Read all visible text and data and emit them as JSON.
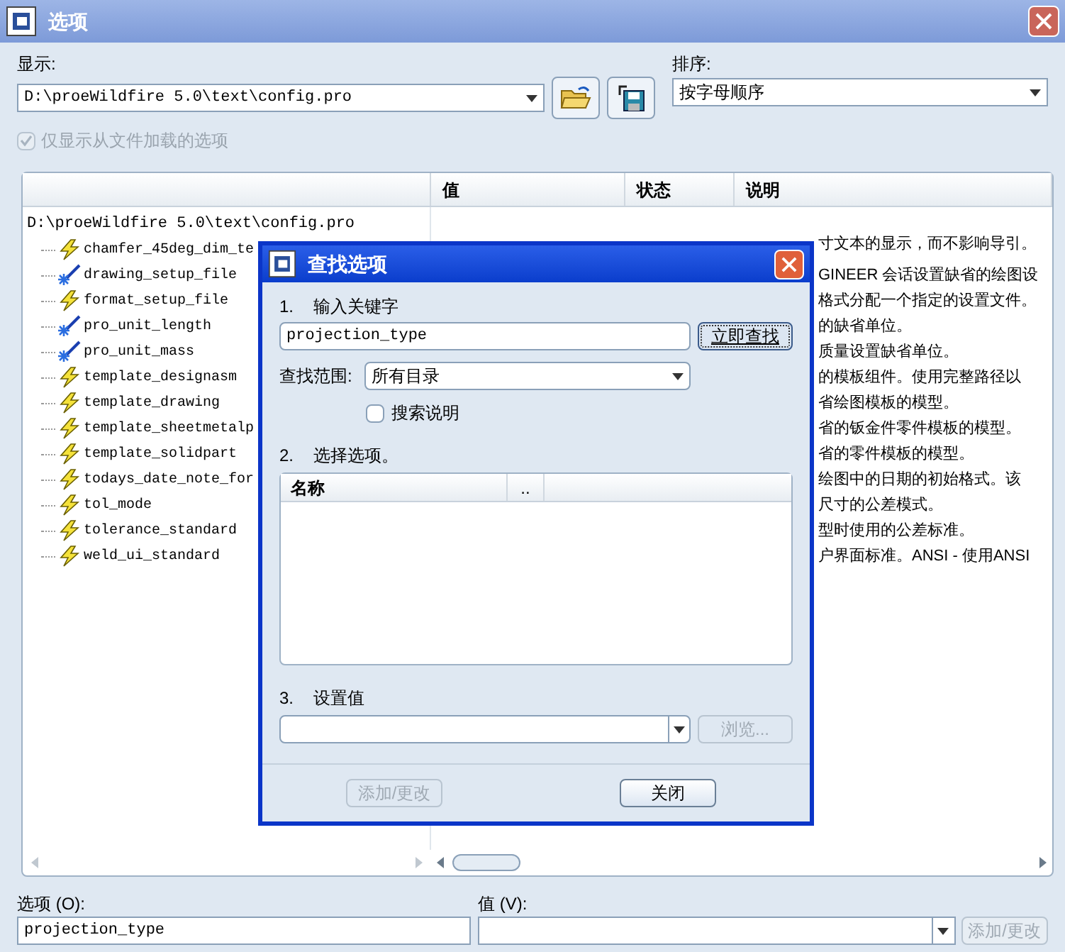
{
  "window": {
    "title": "选项"
  },
  "display": {
    "label": "显示:",
    "value": "D:\\proeWildfire 5.0\\text\\config.pro"
  },
  "sort": {
    "label": "排序:",
    "value": "按字母顺序"
  },
  "only_loaded": {
    "label": "仅显示从文件加载的选项",
    "checked": true,
    "disabled": true
  },
  "table": {
    "columns": [
      "值",
      "状态",
      "说明"
    ],
    "root": "D:\\proeWildfire 5.0\\text\\config.pro",
    "rows": [
      {
        "name": "chamfer_45deg_dim_te",
        "kind": "default",
        "description": "寸文本的显示，而不影响导引。"
      },
      {
        "name": "drawing_setup_file",
        "kind": "changed",
        "description": "GINEER 会话设置缺省的绘图设"
      },
      {
        "name": "format_setup_file",
        "kind": "default",
        "description": "格式分配一个指定的设置文件。"
      },
      {
        "name": "pro_unit_length",
        "kind": "changed",
        "description": "的缺省单位。"
      },
      {
        "name": "pro_unit_mass",
        "kind": "changed",
        "description": "质量设置缺省单位。"
      },
      {
        "name": "template_designasm",
        "kind": "default",
        "description": "的模板组件。使用完整路径以"
      },
      {
        "name": "template_drawing",
        "kind": "default",
        "description": "省绘图模板的模型。"
      },
      {
        "name": "template_sheetmetalp",
        "kind": "default",
        "description": "省的钣金件零件模板的模型。"
      },
      {
        "name": "template_solidpart",
        "kind": "default",
        "description": "省的零件模板的模型。"
      },
      {
        "name": "todays_date_note_for",
        "kind": "default",
        "description": "绘图中的日期的初始格式。该"
      },
      {
        "name": "tol_mode",
        "kind": "default",
        "description": "尺寸的公差模式。"
      },
      {
        "name": "tolerance_standard",
        "kind": "default",
        "description": "型时使用的公差标准。"
      },
      {
        "name": "weld_ui_standard",
        "kind": "default",
        "description": "户界面标准。ANSI - 使用ANSI"
      }
    ]
  },
  "option": {
    "label": "选项 (O):",
    "value": "projection_type"
  },
  "value": {
    "label": "值 (V):",
    "button": "添加/更改",
    "button_disabled": true
  },
  "dialog": {
    "title": "查找选项",
    "step1": "1.",
    "step1_label": "输入关键字",
    "keyword": "projection_type",
    "find_button": "立即查找",
    "scope_label": "查找范围:",
    "scope": "所有目录",
    "search_desc": {
      "label": "搜索说明",
      "checked": false
    },
    "step2": "2.",
    "step2_label": "选择选项。",
    "list_columns": [
      "名称",
      ".."
    ],
    "step3": "3.",
    "step3_label": "设置值",
    "browse": {
      "label": "浏览...",
      "disabled": true
    },
    "add": {
      "label": "添加/更改",
      "disabled": true
    },
    "close": "关闭"
  }
}
